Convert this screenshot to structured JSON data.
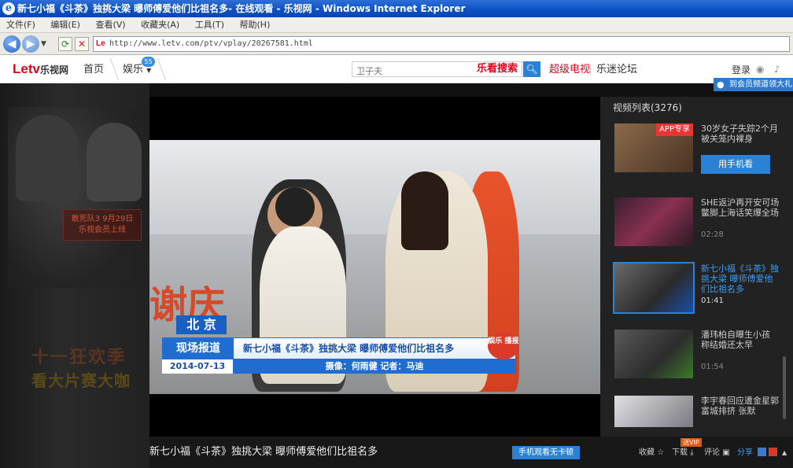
{
  "window": {
    "title": "新七小福《斗茶》独挑大梁 曝师傅爱他们比祖名多- 在线观看 - 乐视网 - Windows Internet Explorer"
  },
  "menu": [
    "文件(F)",
    "编辑(E)",
    "查看(V)",
    "收藏夹(A)",
    "工具(T)",
    "帮助(H)"
  ],
  "address": {
    "url": "http://www.letv.com/ptv/vplay/20267581.html",
    "favicon": "Le"
  },
  "header": {
    "logo_main": "Letv",
    "logo_sub": "乐视网",
    "nav_home": "首页",
    "nav_ent": "娱乐",
    "badge": "55",
    "search_placeholder": "卫子夫",
    "search_brand": "乐看搜索",
    "link_super_tv": "超级电视",
    "link_forum": "乐迷论坛",
    "login": "登录",
    "vip_banner": "到会员频道领大礼"
  },
  "left_ad": {
    "tag_line1": "敢死队3 9月29日",
    "tag_line2": "乐视会员上线",
    "big_line1": "十一狂欢季",
    "big_line2": "看大片赛大咖"
  },
  "video_overlay": {
    "city": "北 京",
    "report": "现场报道",
    "headline": "新七小福《斗茶》独挑大梁 曝师傅爱他们比祖名多",
    "date": "2014-07-13",
    "credit": "摄像：何雨健   记者：马迪",
    "logo": "娱乐 播报"
  },
  "playlist": {
    "title": "视频列表(3276)",
    "items": [
      {
        "title": "30岁女子失踪2个月 被关笼内裸身",
        "duration": "",
        "badge": "APP专享",
        "button": "用手机看"
      },
      {
        "title": "SHE返沪再开安可场 鳖脚上海话笑爆全场",
        "duration": "02:28"
      },
      {
        "title": "新七小福《斗茶》独挑大梁 曝师傅爱他们比祖名多",
        "duration": "01:41",
        "active": true
      },
      {
        "title": "潘玮柏自曝生小孩 称结婚还太早",
        "duration": "01:54"
      },
      {
        "title": "李宇春回应遭金星郭富城排挤 张默",
        "duration": ""
      }
    ]
  },
  "bottom": {
    "video_title": "新七小福《斗茶》独挑大梁 曝师傅爱他们比祖名多",
    "mobile_btn": "手机观看无卡顿",
    "favorite": "收藏",
    "download": "下载",
    "vip_tag": "送VIP",
    "comment": "评论",
    "share": "分享"
  },
  "colors": {
    "brand_red": "#e3001b",
    "accent_blue": "#2a82d6"
  }
}
